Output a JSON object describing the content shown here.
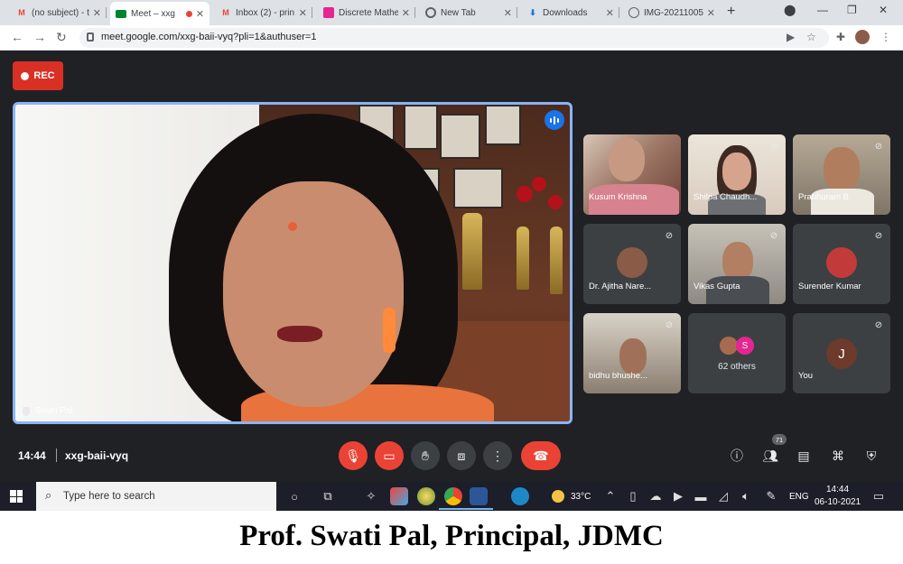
{
  "browser": {
    "tabs": [
      {
        "label": "(no subject) - t",
        "icon": "gmail-icon",
        "active": false
      },
      {
        "label": "Meet – xxg",
        "icon": "meet-icon",
        "active": true
      },
      {
        "label": "Inbox (2) - prin",
        "icon": "gmail-icon",
        "active": false
      },
      {
        "label": "Discrete Mathe",
        "icon": "classroom-icon",
        "active": false
      },
      {
        "label": "New Tab",
        "icon": "chrome-icon",
        "active": false
      },
      {
        "label": "Downloads",
        "icon": "download-icon",
        "active": false
      },
      {
        "label": "IMG-20211005",
        "icon": "globe-icon",
        "active": false
      }
    ],
    "url": "meet.google.com/xxg-baii-vyq?pli=1&authuser=1"
  },
  "meet": {
    "rec_label": "REC",
    "main_speaker": "Swati Pal",
    "participants": [
      {
        "name": "Kusum Krishna",
        "type": "video",
        "muted": false
      },
      {
        "name": "Shilpa Chaudh...",
        "type": "video",
        "muted": false
      },
      {
        "name": "Prabhuram B",
        "type": "video",
        "muted": true
      },
      {
        "name": "Dr. Ajitha Nare...",
        "type": "avatar",
        "muted": true
      },
      {
        "name": "Vikas Gupta",
        "type": "video",
        "muted": true
      },
      {
        "name": "Surender Kumar",
        "type": "avatar",
        "muted": true
      },
      {
        "name": "bidhu bhushe...",
        "type": "video",
        "muted": true
      },
      {
        "name": "62 others",
        "type": "others",
        "muted": false
      },
      {
        "name": "You",
        "type": "avatar",
        "muted": true,
        "initial": "J"
      }
    ],
    "others_initial": "S",
    "time": "14:44",
    "meeting_code": "xxg-baii-vyq",
    "people_count": "71"
  },
  "taskbar": {
    "search_placeholder": "Type here to search",
    "temperature": "33°C",
    "language": "ENG",
    "clock_time": "14:44",
    "clock_date": "06-10-2021"
  },
  "caption": "Prof. Swati Pal, Principal, JDMC",
  "colors": {
    "meet_bg": "#202124",
    "rec_red": "#d93025",
    "speaker_blue": "#8ab4f8",
    "end_call_red": "#ea4335"
  }
}
